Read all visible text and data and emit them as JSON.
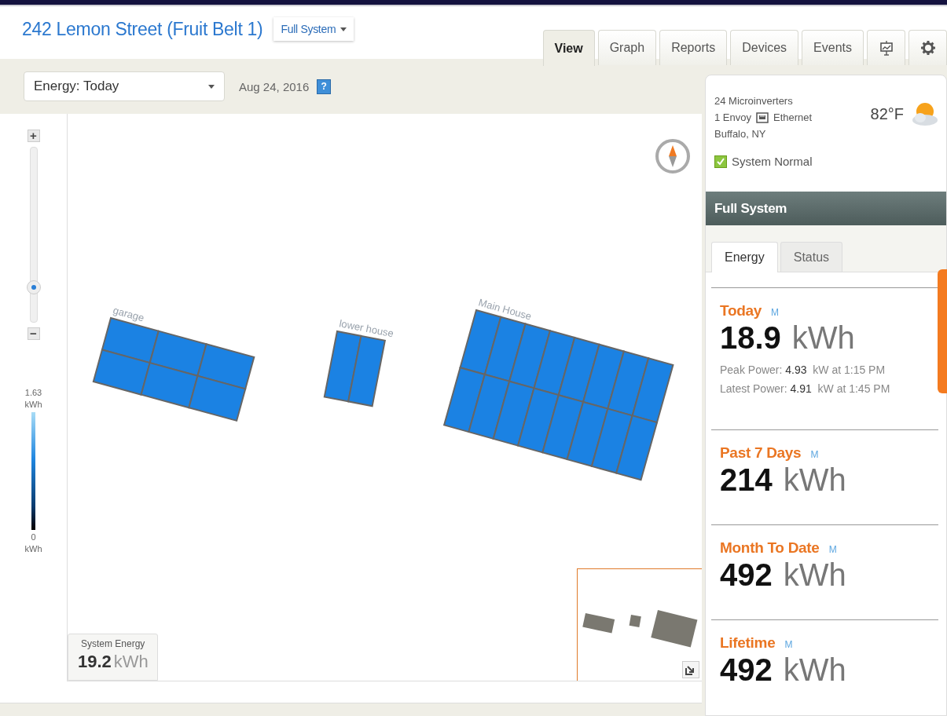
{
  "header": {
    "title": "242 Lemon Street (Fruit Belt 1)",
    "system_menu": "Full System"
  },
  "tabs": [
    {
      "label": "View",
      "selected": true
    },
    {
      "label": "Graph",
      "selected": false
    },
    {
      "label": "Reports",
      "selected": false
    },
    {
      "label": "Devices",
      "selected": false
    },
    {
      "label": "Events",
      "selected": false
    }
  ],
  "icon_tabs": [
    {
      "kind": "display",
      "selected": false
    },
    {
      "kind": "settings",
      "selected": false
    }
  ],
  "toolbar": {
    "energy_select": "Energy: Today",
    "date": "Aug 24, 2016",
    "help": "?"
  },
  "zoom": {
    "plus": "+",
    "minus": "−",
    "level": 0.2
  },
  "legend": {
    "max": "1.63",
    "max_unit": "kWh",
    "min": "0",
    "min_unit": "kWh"
  },
  "arrays": [
    {
      "label": "garage"
    },
    {
      "label": "lower house"
    },
    {
      "label": "Main House"
    }
  ],
  "system_energy": {
    "label": "System Energy",
    "value": "19.2",
    "unit": "kWh"
  },
  "panel": {
    "microinverters": "24 Microinverters",
    "envoy": "1 Envoy",
    "connection": "Ethernet",
    "location": "Buffalo, NY",
    "temperature": "82°F",
    "status": {
      "label": "System Normal",
      "ok": true
    },
    "section_title": "Full System",
    "tabs": [
      {
        "label": "Energy",
        "selected": true
      },
      {
        "label": "Status",
        "selected": false
      }
    ],
    "stats": [
      {
        "label": "Today",
        "badge": "M",
        "value": "18.9",
        "unit": "kWh",
        "details": [
          "Peak Power: **4.93**  kW at 1:15 PM",
          "Latest Power: **4.91**  kW at 1:45 PM"
        ]
      },
      {
        "label": "Past 7 Days",
        "badge": "M",
        "value": "214",
        "unit": "kWh"
      },
      {
        "label": "Month To Date",
        "badge": "M",
        "value": "492",
        "unit": "kWh"
      },
      {
        "label": "Lifetime",
        "badge": "M",
        "value": "492",
        "unit": "kWh"
      }
    ]
  }
}
